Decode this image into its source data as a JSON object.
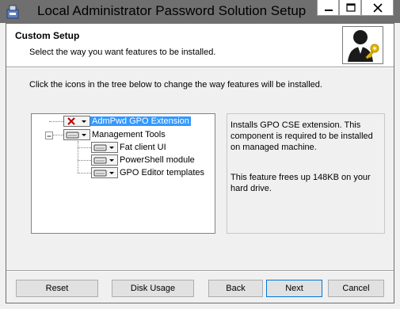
{
  "window": {
    "title": "Local Administrator Password Solution Setup",
    "controls": [
      "minimize-icon",
      "maximize-icon",
      "close-icon"
    ]
  },
  "banner": {
    "title": "Custom Setup",
    "subtitle": "Select the way you want features to be installed."
  },
  "instructions": "Click the icons in the tree below to change the way features will be installed.",
  "tree": {
    "items": [
      {
        "label": "AdmPwd GPO Extension",
        "state_icon": "cross-icon",
        "selected": true
      },
      {
        "label": "Management Tools",
        "state_icon": "drive-icon",
        "expanded": true
      },
      {
        "label": "Fat client UI",
        "state_icon": "drive-icon"
      },
      {
        "label": "PowerShell module",
        "state_icon": "drive-icon"
      },
      {
        "label": "GPO Editor templates",
        "state_icon": "drive-icon"
      }
    ]
  },
  "description": {
    "text": "Installs GPO CSE extension. This component is required to be installed on managed machine.",
    "space": "This feature frees up 148KB on your hard drive."
  },
  "buttons": {
    "reset": "Reset",
    "disk_usage": "Disk Usage",
    "back": "Back",
    "next": "Next",
    "cancel": "Cancel"
  },
  "colors": {
    "titlebar": "#6f6f6f",
    "selection": "#3399ff",
    "error_cross": "#c00000",
    "key_gold": "#e8b800"
  }
}
